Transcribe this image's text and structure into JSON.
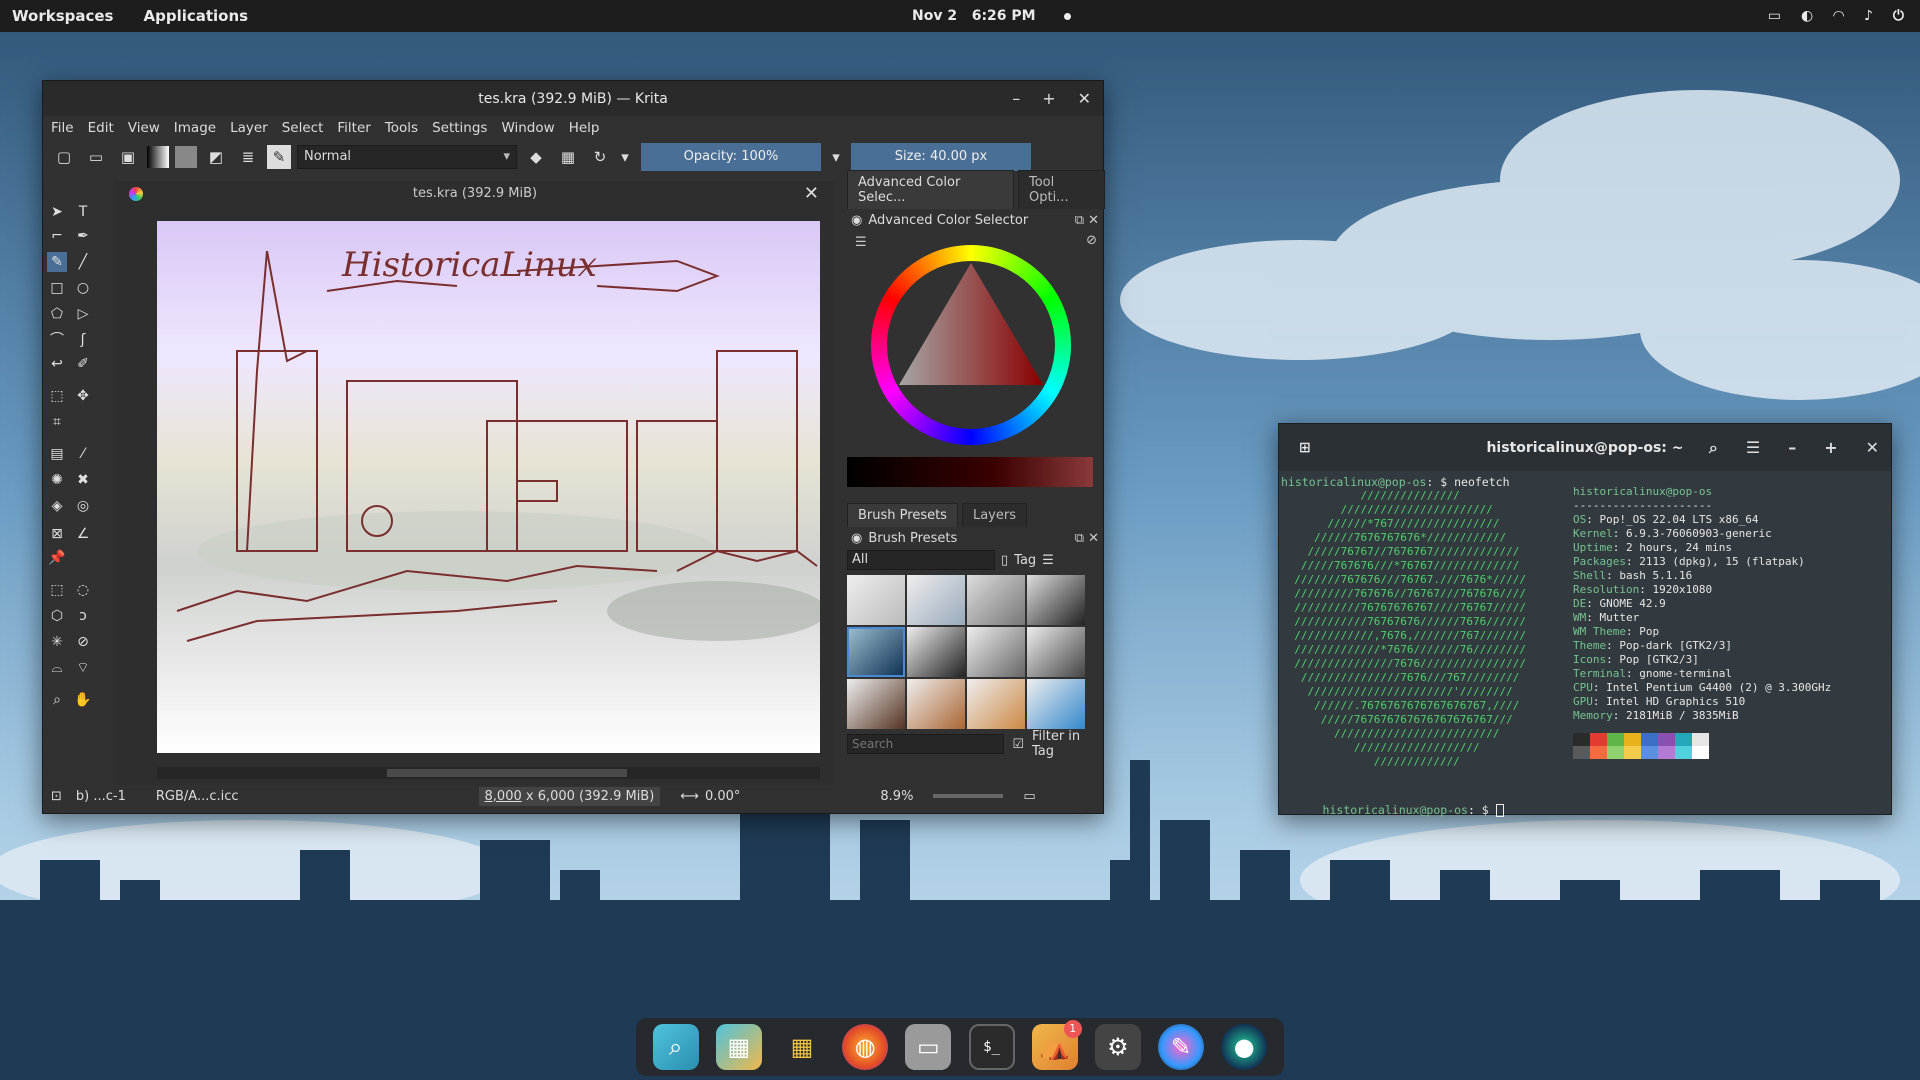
{
  "topbar": {
    "workspaces": "Workspaces",
    "applications": "Applications",
    "date": "Nov 2",
    "time": "6:26 PM"
  },
  "krita": {
    "title": "tes.kra (392.9 MiB) — Krita",
    "menu": [
      "File",
      "Edit",
      "View",
      "Image",
      "Layer",
      "Select",
      "Filter",
      "Tools",
      "Settings",
      "Window",
      "Help"
    ],
    "blend_mode": "Normal",
    "opacity": "Opacity: 100%",
    "size": "Size: 40.00 px",
    "document_title": "tes.kra (392.9 MiB)",
    "canvas_text": "HistoricaLinux",
    "docker_tabs": [
      "Advanced Color Selec...",
      "Tool Opti..."
    ],
    "color_selector_title": "Advanced Color Selector",
    "brush_tabs": [
      "Brush Presets",
      "Layers"
    ],
    "brush_presets_title": "Brush Presets",
    "brush_filter": "All",
    "tag_label": "Tag",
    "search_placeholder": "Search",
    "filter_in_tag": "Filter in Tag",
    "status": {
      "brush": "b) ...c-1",
      "profile": "RGB/A...c.icc",
      "dimensions_w": "8,000",
      "dimensions_rest": " x 6,000 (392.9 MiB)",
      "rotation": "0.00°",
      "zoom": "8.9%"
    }
  },
  "terminal": {
    "title": "historicalinux@pop-os: ~",
    "prompt": "historicalinux@pop-os",
    "command": "$ neofetch",
    "logo": [
      "            ///////////////           ",
      "         ///////////////////////      ",
      "       //////*767////////////////     ",
      "     //////7676767676*////////////    ",
      "    /////76767//7676767/////////////  ",
      "   /////767676///*76767/////////////  ",
      "  ///////767676///76767.///7676*///// ",
      "  /////////767676//76767///767676//// ",
      "  //////////76767676767////76767///// ",
      "  ///////////76767676//////7676////// ",
      "  ////////////,7676,///////767/////// ",
      "  /////////////*7676///////76//////// ",
      "  ///////////////7676//////////////// ",
      "   ///////////////7676///767//////// ",
      "    //////////////////////'////////  ",
      "     //////.7676767676767676767,////  ",
      "      /////767676767676767676767/// ",
      "        ///////////////////////// ",
      "           ///////////////////      ",
      "              /////////////       "
    ],
    "user_host": "historicalinux@pop-os",
    "separator": "---------------------",
    "info": [
      {
        "k": "OS",
        "v": "Pop!_OS 22.04 LTS x86_64"
      },
      {
        "k": "Kernel",
        "v": "6.9.3-76060903-generic"
      },
      {
        "k": "Uptime",
        "v": "2 hours, 24 mins"
      },
      {
        "k": "Packages",
        "v": "2113 (dpkg), 15 (flatpak)"
      },
      {
        "k": "Shell",
        "v": "bash 5.1.16"
      },
      {
        "k": "Resolution",
        "v": "1920x1080"
      },
      {
        "k": "DE",
        "v": "GNOME 42.9"
      },
      {
        "k": "WM",
        "v": "Mutter"
      },
      {
        "k": "WM Theme",
        "v": "Pop"
      },
      {
        "k": "Theme",
        "v": "Pop-dark [GTK2/3]"
      },
      {
        "k": "Icons",
        "v": "Pop [GTK2/3]"
      },
      {
        "k": "Terminal",
        "v": "gnome-terminal"
      },
      {
        "k": "CPU",
        "v": "Intel Pentium G4400 (2) @ 3.300GHz"
      },
      {
        "k": "GPU",
        "v": "Intel HD Graphics 510"
      },
      {
        "k": "Memory",
        "v": "2181MiB / 3835MiB"
      }
    ],
    "palette": [
      "#2b2b2b",
      "#e33b2f",
      "#5fb548",
      "#e7b21c",
      "#3a6fc5",
      "#8a4fb0",
      "#22a8b8",
      "#e6e6e6",
      "#5a5a5a",
      "#f56a3f",
      "#8fd06f",
      "#f3cd4a",
      "#5b8fe0",
      "#b27ad3",
      "#4fd2dd",
      "#ffffff"
    ],
    "bottom_prompt": "historicalinux@pop-os",
    "bottom_suffix": ": $"
  },
  "dock": {
    "notification_count": "1"
  }
}
